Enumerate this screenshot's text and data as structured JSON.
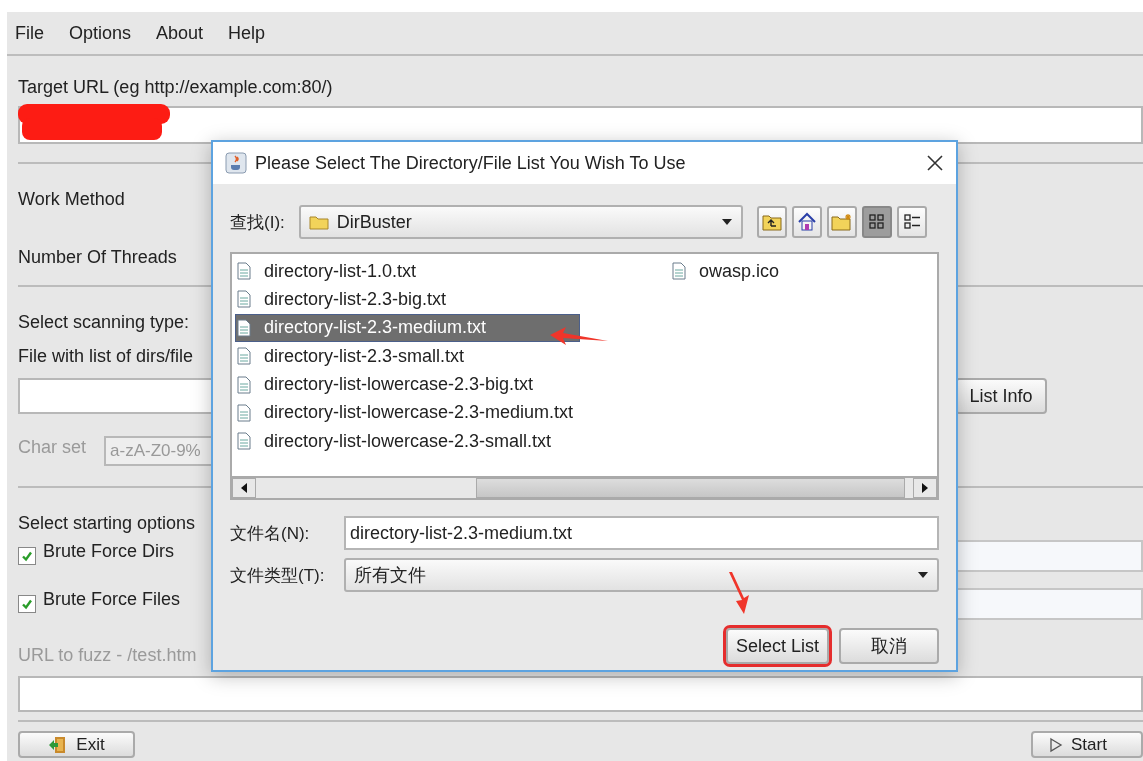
{
  "menu": [
    "File",
    "Options",
    "About",
    "Help"
  ],
  "form": {
    "target_label": "Target URL (eg http://example.com:80/)",
    "target_redacted": true,
    "work_method_label": "Work Method",
    "threads_label": "Number Of Threads",
    "scan_type_label": "Select scanning type:",
    "list_file_label": "File with list of dirs/file",
    "list_info_button": "List Info",
    "charset_label": "Char set",
    "charset_value": "a-zA-Z0-9%",
    "charset_disabled": true,
    "start_options_label": "Select starting options",
    "options": [
      {
        "label": "Brute Force Dirs",
        "checked": true
      },
      {
        "label": "Brute Force Files",
        "checked": true
      }
    ],
    "fuzz_label": "URL to fuzz - /test.htm",
    "fuzz_disabled": true,
    "exit_button": "Exit",
    "start_button": "Start"
  },
  "dialog": {
    "title": "Please Select The Directory/File List You Wish To Use",
    "look_in_label": "查找(I):",
    "look_in_value": "DirBuster",
    "toolbar": [
      {
        "kind": "up",
        "selected": false
      },
      {
        "kind": "home",
        "selected": false
      },
      {
        "kind": "newfolder",
        "selected": false
      },
      {
        "kind": "list",
        "selected": true
      },
      {
        "kind": "details",
        "selected": false
      }
    ],
    "files": [
      {
        "name": "directory-list-1.0.txt",
        "selected": false
      },
      {
        "name": "directory-list-2.3-big.txt",
        "selected": false
      },
      {
        "name": "directory-list-2.3-medium.txt",
        "selected": true
      },
      {
        "name": "directory-list-2.3-small.txt",
        "selected": false
      },
      {
        "name": "directory-list-lowercase-2.3-big.txt",
        "selected": false
      },
      {
        "name": "directory-list-lowercase-2.3-medium.txt",
        "selected": false
      },
      {
        "name": "directory-list-lowercase-2.3-small.txt",
        "selected": false
      },
      {
        "name": "owasp.ico",
        "selected": false
      }
    ],
    "filename_label": "文件名(N):",
    "filename_value": "directory-list-2.3-medium.txt",
    "filetype_label": "文件类型(T):",
    "filetype_value": "所有文件",
    "buttons": [
      {
        "label": "Select List",
        "highlighted": true
      },
      {
        "label": "取消",
        "highlighted": false
      }
    ]
  }
}
